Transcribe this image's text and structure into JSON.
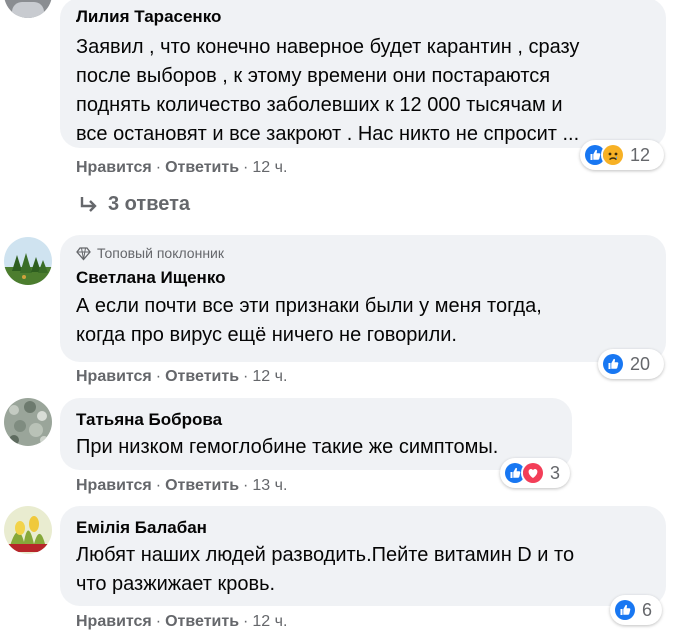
{
  "comments": [
    {
      "author": "Лилия Тарасенко",
      "lines": [
        "Заявил , что конечно наверное будет карантин , сразу",
        "после выборов , к этому времени они постараются",
        "поднять количество заболевших к 12 000 тысячам и",
        "все остановят и все закроют . Нас никто не спросит ..."
      ],
      "like_label": "Нравится",
      "reply_label": "Ответить",
      "time": "12 ч.",
      "reaction_count": "12",
      "reactions": [
        "like",
        "sad"
      ],
      "replies_label": "3 ответа"
    },
    {
      "badge": "Топовый поклонник",
      "author": "Светлана Ищенко",
      "lines": [
        "А если почти все эти признаки были у меня тогда,",
        "когда про вирус ещё ничего не говорили."
      ],
      "like_label": "Нравится",
      "reply_label": "Ответить",
      "time": "12 ч.",
      "reaction_count": "20",
      "reactions": [
        "like"
      ]
    },
    {
      "author": "Татьяна Боброва",
      "lines": [
        "При низком гемоглобине такие же симптомы."
      ],
      "like_label": "Нравится",
      "reply_label": "Ответить",
      "time": "13 ч.",
      "reaction_count": "3",
      "reactions": [
        "like",
        "love"
      ]
    },
    {
      "author": "Емілія Балабан",
      "lines": [
        "Любят наших людей разводить.Пейте витамин D и то",
        "что разжижает кровь."
      ],
      "like_label": "Нравится",
      "reply_label": "Ответить",
      "time": "12 ч.",
      "reaction_count": "6",
      "reactions": [
        "like"
      ]
    }
  ],
  "separator": "·",
  "colors": {
    "bubble": "#f0f2f5",
    "meta_text": "#65676b",
    "like_blue": "#1877f2",
    "love_red": "#f33e58",
    "sad_yellow": "#f7b125"
  },
  "icons": {
    "like": "thumbs-up-icon",
    "sad": "sad-face-icon",
    "love": "heart-icon",
    "reply_arrow": "reply-arrow-icon",
    "badge": "diamond-icon"
  }
}
